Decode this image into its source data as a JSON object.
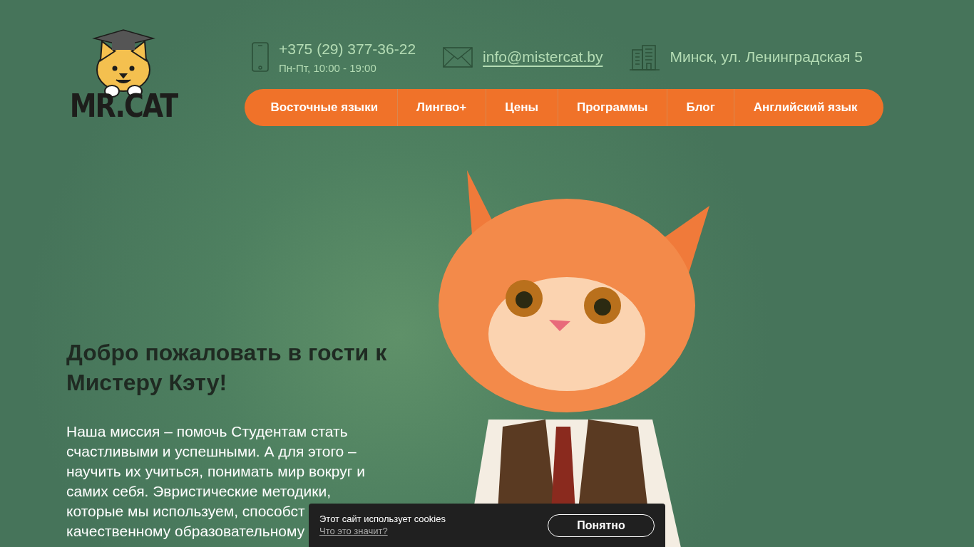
{
  "logo": {
    "text": "MR.CAT"
  },
  "contacts": {
    "phone": "+375 (29) 377-36-22",
    "hours": "Пн-Пт, 10:00 - 19:00",
    "email": "info@mistercat.by",
    "address": "Минск, ул. Ленинградская 5"
  },
  "nav": [
    "Восточные языки",
    "Лингво+",
    "Цены",
    "Программы",
    "Блог",
    "Английский язык"
  ],
  "hero": {
    "title": "Добро пожаловать в гости к Мистеру Кэту!",
    "mission_lines": [
      "Наша миссия – помочь Студентам стать",
      "счастливыми и успешными. А для этого –",
      "научить их учиться, понимать мир вокруг и",
      "самих себя. Эвристические методики,",
      "которые мы используем, способст",
      "качественному образовательному"
    ]
  },
  "cookie_banner": {
    "text": "Этот сайт использует cookies",
    "link": "Что это значит?",
    "button": "Понятно"
  }
}
